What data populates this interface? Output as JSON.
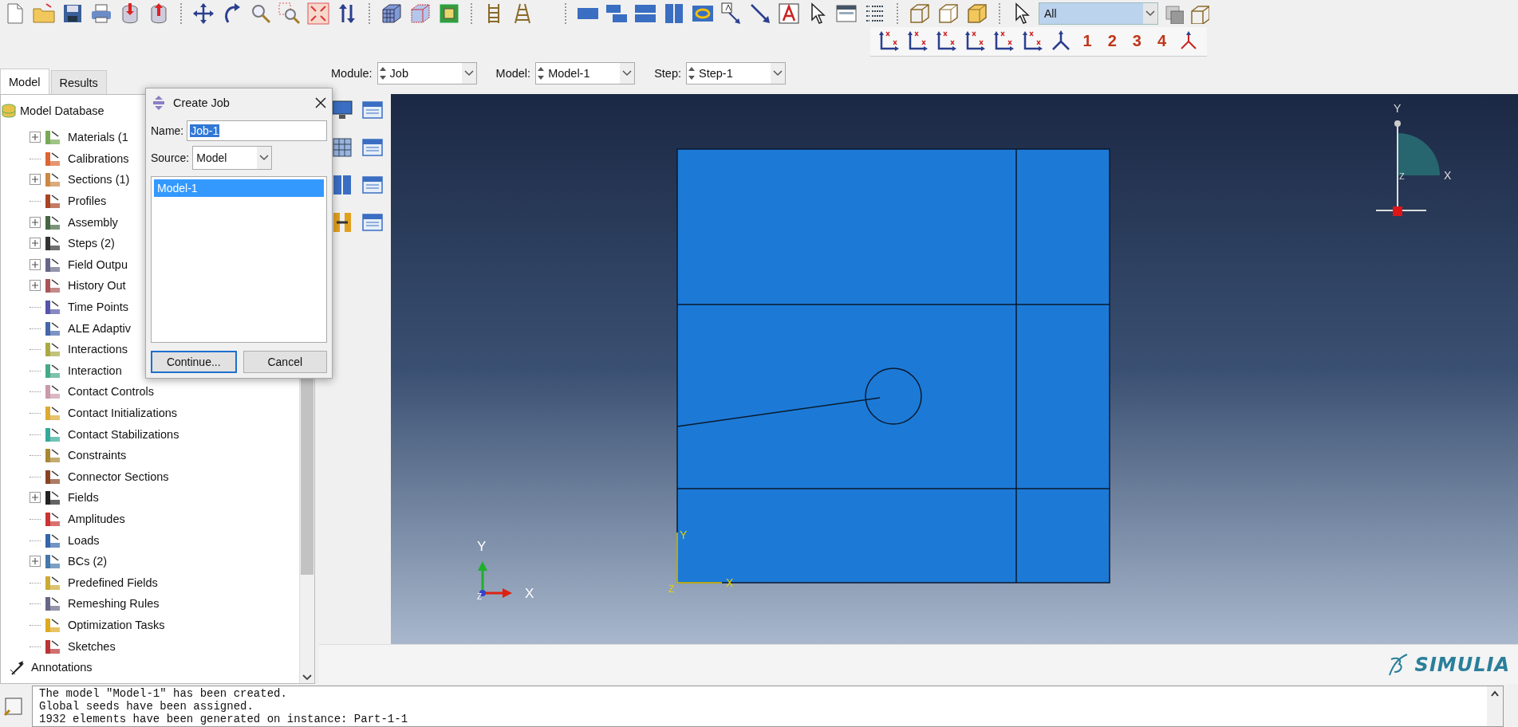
{
  "toolbar": {
    "selection_filter": "All",
    "view_buttons": [
      "1",
      "2",
      "3",
      "4"
    ]
  },
  "tabs": [
    {
      "label": "Model",
      "selected": true
    },
    {
      "label": "Results",
      "selected": false
    }
  ],
  "context_bar": {
    "fields": [
      {
        "label": "Module:",
        "value": "Job"
      },
      {
        "label": "Model:",
        "value": "Model-1"
      },
      {
        "label": "Step:",
        "value": "Step-1"
      }
    ]
  },
  "tree": {
    "root": "Model Database",
    "items": [
      {
        "children": [
          {
            "label": "Materials (1",
            "expandable": true
          },
          {
            "label": "Calibrations",
            "expandable": false
          },
          {
            "label": "Sections (1)",
            "expandable": true
          },
          {
            "label": "Profiles",
            "expandable": false
          },
          {
            "label": "Assembly",
            "expandable": true
          },
          {
            "label": "Steps (2)",
            "expandable": true
          },
          {
            "label": "Field Outpu",
            "expandable": true
          },
          {
            "label": "History Out",
            "expandable": true
          },
          {
            "label": "Time Points",
            "expandable": false
          },
          {
            "label": "ALE Adaptiv",
            "expandable": false
          },
          {
            "label": "Interactions",
            "expandable": false
          },
          {
            "label": "Interaction",
            "expandable": false
          },
          {
            "label": "Contact Controls",
            "expandable": false
          },
          {
            "label": "Contact Initializations",
            "expandable": false
          },
          {
            "label": "Contact Stabilizations",
            "expandable": false
          },
          {
            "label": "Constraints",
            "expandable": false
          },
          {
            "label": "Connector Sections",
            "expandable": false
          },
          {
            "label": "Fields",
            "expandable": true
          },
          {
            "label": "Amplitudes",
            "expandable": false
          },
          {
            "label": "Loads",
            "expandable": false
          },
          {
            "label": "BCs (2)",
            "expandable": true
          },
          {
            "label": "Predefined Fields",
            "expandable": false
          },
          {
            "label": "Remeshing Rules",
            "expandable": false
          },
          {
            "label": "Optimization Tasks",
            "expandable": false
          },
          {
            "label": "Sketches",
            "expandable": false
          }
        ]
      },
      {
        "label": "Annotations",
        "expandable": false
      }
    ]
  },
  "dialog": {
    "title": "Create Job",
    "name_label": "Name:",
    "name_value": "Job-1",
    "name_selected": true,
    "source_label": "Source:",
    "source_value": "Model",
    "list": [
      {
        "label": "Model-1",
        "selected": true
      }
    ],
    "buttons": [
      {
        "label": "Continue...",
        "default": true
      },
      {
        "label": "Cancel",
        "default": false
      }
    ]
  },
  "viewport": {
    "compass": {
      "y": "Y",
      "x": "X",
      "z": "Z"
    },
    "part_axes": {
      "y": "Y",
      "x": "X",
      "z": "Z"
    },
    "triad": {
      "y": "Y",
      "x": "X",
      "z": "Z"
    }
  },
  "brand": "SIMULIA",
  "messages": [
    "The model \"Model-1\" has been created.",
    "Global seeds have been assigned.",
    "1932 elements have been generated on instance: Part-1-1"
  ]
}
